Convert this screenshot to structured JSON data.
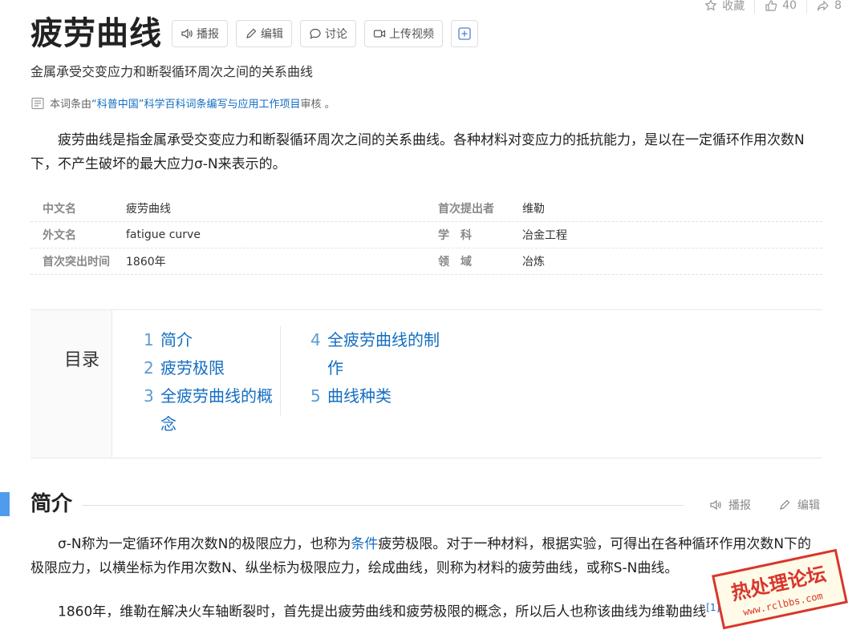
{
  "stats": {
    "favorite": "收藏",
    "likes": "40",
    "shares": "8"
  },
  "title": "疲劳曲线",
  "toolbar": {
    "broadcast": "播报",
    "edit": "编辑",
    "discuss": "讨论",
    "upload": "上传视频"
  },
  "subtitle": "金属承受交变应力和断裂循环周次之间的关系曲线",
  "review": {
    "prefix": "本词条由",
    "link": "“科普中国”科学百科词条编写与应用工作项目",
    "suffix": " 审核 。"
  },
  "lead": "疲劳曲线是指金属承受交变应力和断裂循环周次之间的关系曲线。各种材料对变应力的抵抗能力，是以在一定循环作用次数N下，不产生破坏的最大应力σ-N来表示的。",
  "infobox": [
    {
      "k1": "中文名",
      "v1": "疲劳曲线",
      "k2": "首次提出者",
      "v2": "维勒"
    },
    {
      "k1": "外文名",
      "v1": "fatigue curve",
      "k2": "学　科",
      "v2": "冶金工程"
    },
    {
      "k1": "首次突出时间",
      "v1": "1860年",
      "k2": "领　域",
      "v2": "冶炼"
    }
  ],
  "toc": {
    "heading": "目录",
    "items": [
      {
        "num": "1",
        "text": "简介"
      },
      {
        "num": "2",
        "text": "疲劳极限"
      },
      {
        "num": "3",
        "text": "全疲劳曲线的概念"
      },
      {
        "num": "4",
        "text": "全疲劳曲线的制作"
      },
      {
        "num": "5",
        "text": "曲线种类"
      }
    ]
  },
  "section": {
    "title": "简介",
    "broadcast": "播报",
    "edit": "编辑"
  },
  "para1": {
    "before": "σ-N称为一定循环作用次数N的极限应力，也称为",
    "link": "条件",
    "after": "疲劳极限。对于一种材料，根据实验，可得出在各种循环作用次数N下的极限应力，以横坐标为作用次数N、纵坐标为极限应力，绘成曲线，则称为材料的疲劳曲线，或称S-N曲线。"
  },
  "para2": {
    "text": "1860年，维勒在解决火车轴断裂时，首先提出疲劳曲线和疲劳极限的概念，所以后人也称该曲线为维勒曲线",
    "ref": "[1]"
  },
  "watermark": {
    "text": "热处理论坛",
    "url": "www.rclbbs.com"
  }
}
